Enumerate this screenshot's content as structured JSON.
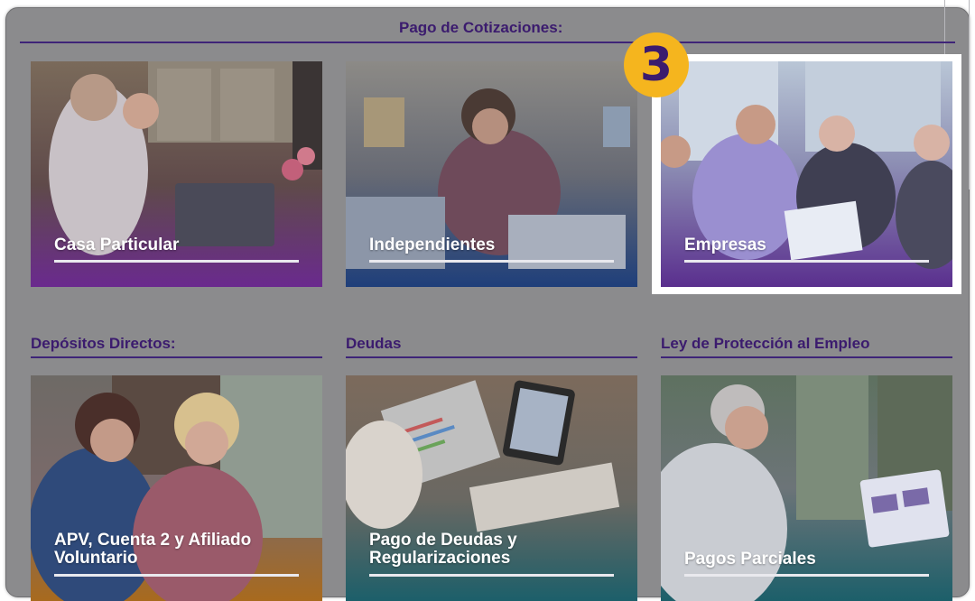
{
  "header": {
    "title": "Pago de Cotizaciones:"
  },
  "step_badge": "3",
  "sections": {
    "depositos": "Depósitos Directos:",
    "deudas": "Deudas",
    "ley": "Ley de Protección al Empleo"
  },
  "cards": {
    "casa_particular": "Casa Particular",
    "independientes": "Independientes",
    "empresas": "Empresas",
    "apv_line1": "APV, Cuenta 2 y Afiliado",
    "apv_line2": "Voluntario",
    "deudas_line1": "Pago de Deudas y",
    "deudas_line2": "Regularizaciones",
    "pagos_parciales": "Pagos Parciales"
  },
  "colors": {
    "accent": "#3b1b6e",
    "badge": "#f5b51e",
    "overlay_purple": "#6a2a8e",
    "overlay_blue": "#1f3f7a",
    "overlay_gold": "#a86a1e",
    "overlay_teal": "#1c5f6a"
  }
}
